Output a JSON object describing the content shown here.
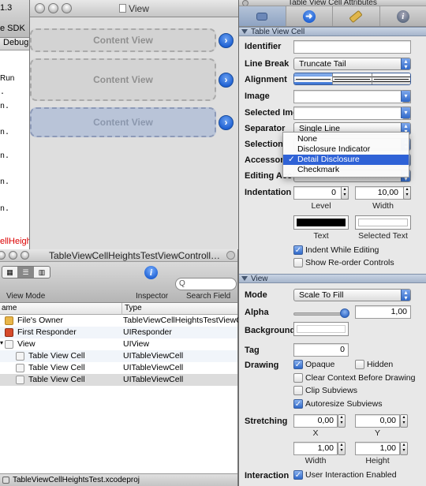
{
  "left_strip": {
    "lines": [
      "1.3",
      "e SDK",
      "Debug",
      "Run"
    ],
    "dots": [
      ".",
      "n.",
      "n.",
      "n.",
      "n.",
      "n."
    ],
    "red_text": "ellHeights"
  },
  "view_window": {
    "title": "View",
    "cells": [
      "Content View",
      "Content View",
      "Content View"
    ],
    "disclosure_glyph": "›"
  },
  "document_window": {
    "title": "TableViewCellHeightsTestViewControll…",
    "toolbar": {
      "view_mode_label": "View Mode",
      "inspector_label": "Inspector",
      "search_label": "Search Field",
      "search_placeholder": "Q",
      "info_glyph": "i"
    },
    "columns": {
      "name": "ame",
      "type": "Type"
    },
    "rows": [
      {
        "name": "File's Owner",
        "type": "TableViewCellHeightsTestViewC…"
      },
      {
        "name": "First Responder",
        "type": "UIResponder"
      },
      {
        "name": "View",
        "type": "UIView"
      },
      {
        "name": "Table View Cell",
        "type": "UITableViewCell"
      },
      {
        "name": "Table View Cell",
        "type": "UITableViewCell"
      },
      {
        "name": "Table View Cell",
        "type": "UITableViewCell"
      }
    ],
    "status": "TableViewCellHeightsTest.xcodeproj"
  },
  "inspector": {
    "title": "Table View Cell Attributes",
    "section_cell": "Table View Cell",
    "labels": {
      "identifier": "Identifier",
      "line_break": "Line Break",
      "alignment": "Alignment",
      "image": "Image",
      "selected_img": "Selected Img",
      "separator": "Separator",
      "selection": "Selection",
      "accessory": "Accessory",
      "editing_acc": "Editing Acc",
      "indentation": "Indentation",
      "level": "Level",
      "width": "Width",
      "text": "Text",
      "selected_text": "Selected Text",
      "indent_while_editing": "Indent While Editing",
      "show_reorder": "Show Re-order Controls"
    },
    "values": {
      "identifier": "",
      "line_break": "Truncate Tail",
      "separator": "Single Line",
      "indent_level": "0",
      "indent_width": "10,00"
    },
    "accessory_menu": {
      "options": [
        "None",
        "Disclosure Indicator",
        "Detail Disclosure",
        "Checkmark"
      ],
      "selected": "Detail Disclosure"
    },
    "colors": {
      "text": "#000000",
      "selected_text": "#ffffff",
      "accent": "#2f62d6"
    },
    "section_view": "View",
    "view_labels": {
      "mode": "Mode",
      "alpha": "Alpha",
      "background": "Background",
      "tag": "Tag",
      "drawing": "Drawing",
      "stretching": "Stretching",
      "x": "X",
      "y": "Y",
      "width": "Width",
      "height": "Height",
      "interaction": "Interaction"
    },
    "view_values": {
      "mode": "Scale To Fill",
      "alpha": "1,00",
      "alpha_slider": 1.0,
      "tag": "0",
      "stretch_x": "0,00",
      "stretch_y": "0,00",
      "stretch_w": "1,00",
      "stretch_h": "1,00"
    },
    "checks": {
      "opaque": "Opaque",
      "hidden": "Hidden",
      "clear_context": "Clear Context Before Drawing",
      "clip_subviews": "Clip Subviews",
      "autoresize": "Autoresize Subviews",
      "user_interaction": "User Interaction Enabled"
    },
    "checkmark_glyph": "✓"
  }
}
